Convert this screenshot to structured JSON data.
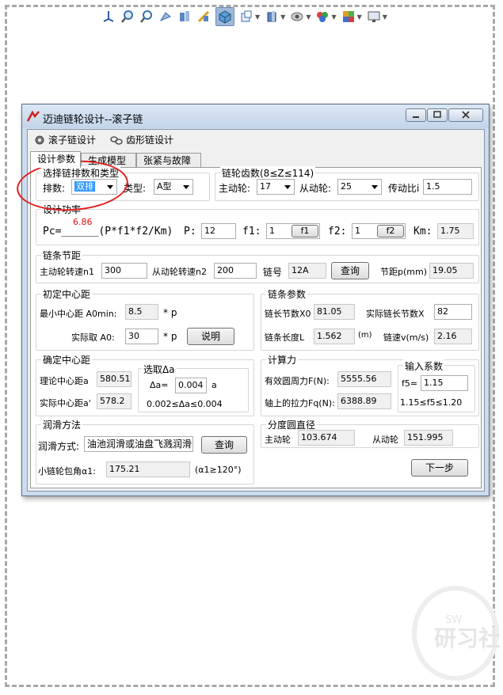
{
  "toolbar": {
    "icons": [
      "view-orientation-icon",
      "zoom-to-fit-icon",
      "zoom-to-area-icon",
      "previous-view-icon",
      "section-view-icon",
      "dynamic-annotation-icon",
      "display-style-icon",
      "view-orientation-cube-icon",
      "hide-show-icon",
      "edit-appearance-icon",
      "apply-scene-icon",
      "view-settings-icon"
    ]
  },
  "window": {
    "title": "迈迪链轮设计--滚子链",
    "menu": [
      "滚子链设计",
      "齿形链设计"
    ],
    "tabs": [
      "设计参数",
      "生成模型",
      "张紧与故障"
    ],
    "active_tab": 0
  },
  "g1": {
    "title": "选择链排数和类型",
    "rows_label": "排数:",
    "rows_value": "双排",
    "type_label": "类型:",
    "type_value": "A型"
  },
  "g2": {
    "title": "链轮齿数(8≤Z≤114)",
    "driver_label": "主动轮:",
    "driver_value": "17",
    "driven_label": "从动轮:",
    "driven_value": "25",
    "ratio_label": "传动比i",
    "ratio_value": "1.5"
  },
  "g3": {
    "title": "设计功率",
    "pc_label": "Pc=______(P*f1*f2/Km)",
    "pc_value": "6.86",
    "p_label": "P:",
    "p_value": "12",
    "f1_label": "f1:",
    "f1_value": "1",
    "f1_btn": "f1",
    "f2_label": "f2:",
    "f2_value": "1",
    "f2_btn": "f2",
    "km_label": "Km:",
    "km_value": "1.75"
  },
  "g4": {
    "title": "链条节距",
    "n1_label": "主动轮转速n1",
    "n1_value": "300",
    "n2_label": "从动轮转速n2",
    "n2_value": "200",
    "chain_label": "链号",
    "chain_value": "12A",
    "query_btn": "查询",
    "pitch_label": "节距p(mm)",
    "pitch_value": "19.05"
  },
  "g5": {
    "title": "初定中心距",
    "min_label": "最小中心距 A0min:",
    "min_value": "8.5",
    "unit_p": "* p",
    "actual_label": "实际取 A0:",
    "actual_value": "30",
    "explain_btn": "说明"
  },
  "g6": {
    "title": "链条参数",
    "x0_label": "链长节数X0",
    "x0_value": "81.05",
    "x_label": "实际链长节数X",
    "x_value": "82",
    "len_label": "链条长度L",
    "len_value": "1.562",
    "len_unit": "(m)",
    "speed_label": "链速v(m/s)",
    "speed_value": "2.16"
  },
  "g7": {
    "title": "确定中心距",
    "theo_label": "理论中心距a",
    "theo_value": "580.51",
    "act_label": "实际中心距a'",
    "act_value": "578.2",
    "sub_title": "选取Δa",
    "delta_label": "Δa=",
    "delta_value": "0.004",
    "delta_unit": "a",
    "range": "0.002≤Δa≤0.004"
  },
  "g8": {
    "title": "计算力",
    "f_label": "有效圆周力F(N):",
    "f_value": "5555.56",
    "fq_label": "轴上的拉力Fq(N):",
    "fq_value": "6388.89",
    "sub_title": "输入系数",
    "f5_label": "f5=",
    "f5_value": "1.15",
    "f5_range": "1.15≤f5≤1.20"
  },
  "g9": {
    "title": "润滑方法",
    "method_label": "润滑方式:",
    "method_value": "油池润滑或油盘飞溅润滑",
    "query_btn": "查询",
    "wrap_label": "小链轮包角α1:",
    "wrap_value": "175.21",
    "wrap_cond": "(α1≥120°)"
  },
  "g10": {
    "title": "分度圆直径",
    "driver_label": "主动轮",
    "driver_value": "103.674",
    "driven_label": "从动轮",
    "driven_value": "151.995"
  },
  "next_btn": "下一步",
  "watermark": {
    "logo": "SW",
    "text": "研习社"
  }
}
